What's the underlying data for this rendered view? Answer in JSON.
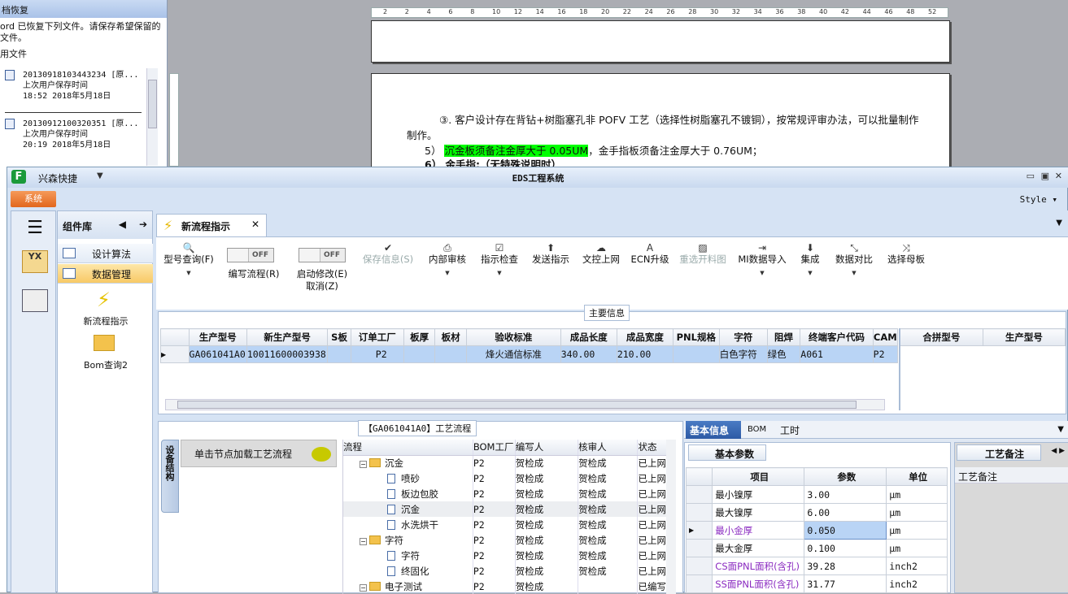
{
  "recovery": {
    "title": "档恢复",
    "message": "ord 已恢复下列文件。请保存希望保留的文件。",
    "section": "用文件",
    "files": [
      {
        "name": "20130918103443234 [原...",
        "label": "上次用户保存时间",
        "time": "18:52 2018年5月18日"
      },
      {
        "name": "20130912100320351 [原...",
        "label": "上次用户保存时间",
        "time": "20:19 2018年5月18日"
      }
    ]
  },
  "ruler": [
    "2",
    "2",
    "4",
    "6",
    "8",
    "10",
    "12",
    "14",
    "16",
    "18",
    "20",
    "22",
    "24",
    "26",
    "28",
    "30",
    "32",
    "34",
    "36",
    "38",
    "40",
    "42",
    "44",
    "46",
    "48",
    "52"
  ],
  "doc": {
    "line1": "③. 客户设计存在背钻+树脂塞孔非 POFV 工艺（选择性树脂塞孔不镀铜），按常规评审办法，可以批量制作",
    "line1b": "制作。",
    "line2_num": "5）",
    "line2_hl": "沉金板须备注金厚大于 0.05UM",
    "line2_rest": "，金手指板须备注金厚大于 0.76UM；",
    "line3": "6） 金手指:（无特殊说明时）"
  },
  "window": {
    "app": "兴森快捷",
    "caption": "EDS工程系统",
    "style": "Style",
    "system_tab": "系统"
  },
  "nav": {
    "lib_title": "组件库",
    "items": [
      "设计算法",
      "数据管理"
    ],
    "big_items": [
      "新流程指示",
      "Bom查询2"
    ]
  },
  "tab": {
    "label": "新流程指示"
  },
  "toolbar": {
    "model_query": "型号查询(F)",
    "write_flow": "编写流程(R)",
    "start_modify": "启动修改(E)",
    "cancel": "取消(Z)",
    "off": "OFF",
    "buttons": [
      "保存信息(S)",
      "内部审核",
      "指示检查",
      "发送指示",
      "文控上网",
      "ECN升级",
      "重选开料图",
      "MI数据导入",
      "集成",
      "数据对比",
      "选择母板"
    ]
  },
  "main": {
    "legend": "主要信息",
    "columns": [
      "生产型号",
      "新生产型号",
      "S板",
      "订单工厂",
      "板厚",
      "板材",
      "验收标准",
      "成品长度",
      "成品宽度",
      "PNL规格",
      "字符",
      "阻焊",
      "终端客户代码",
      "CAM"
    ],
    "row": [
      "GA061041A0",
      "10011600003938",
      "",
      "P2",
      "",
      "",
      "烽火通信标准",
      "340.00",
      "210.00",
      "",
      "白色字符",
      "绿色",
      "A061",
      "P2"
    ],
    "side_columns": [
      "合拼型号",
      "生产型号"
    ]
  },
  "process": {
    "legend": "【GA061041A0】工艺流程",
    "vtab": "设备结构",
    "click": "单击节点加载工艺流程",
    "columns": [
      "流程",
      "BOM工厂",
      "编写人",
      "核审人",
      "状态"
    ],
    "rows": [
      {
        "name": "沉金",
        "f": "P2",
        "w": "贺检成",
        "r": "贺检成",
        "s": "已上网"
      },
      {
        "name": "喷砂",
        "f": "P2",
        "w": "贺检成",
        "r": "贺检成",
        "s": "已上网"
      },
      {
        "name": "板边包胶",
        "f": "P2",
        "w": "贺检成",
        "r": "贺检成",
        "s": "已上网"
      },
      {
        "name": "沉金",
        "f": "P2",
        "w": "贺检成",
        "r": "贺检成",
        "s": "已上网"
      },
      {
        "name": "水洗烘干",
        "f": "P2",
        "w": "贺检成",
        "r": "贺检成",
        "s": "已上网"
      },
      {
        "name": "字符",
        "f": "P2",
        "w": "贺检成",
        "r": "贺检成",
        "s": "已上网"
      },
      {
        "name": "字符",
        "f": "P2",
        "w": "贺检成",
        "r": "贺检成",
        "s": "已上网"
      },
      {
        "name": "终固化",
        "f": "P2",
        "w": "贺检成",
        "r": "贺检成",
        "s": "已上网"
      },
      {
        "name": "电子测试",
        "f": "P2",
        "w": "贺检成",
        "r": "",
        "s": "已编写"
      }
    ]
  },
  "params": {
    "tabs": [
      "基本信息",
      "BOM",
      "工时"
    ],
    "sub_tab": "基本参数",
    "columns": [
      "项目",
      "参数",
      "单位"
    ],
    "rows": [
      {
        "item": "最小镍厚",
        "val": "3.00",
        "unit": "μm"
      },
      {
        "item": "最大镍厚",
        "val": "6.00",
        "unit": "μm"
      },
      {
        "item": "最小金厚",
        "val": "0.050",
        "unit": "μm"
      },
      {
        "item": "最大金厚",
        "val": "0.100",
        "unit": "μm"
      },
      {
        "item": "CS面PNL面积(含孔)",
        "val": "39.28",
        "unit": "inch2"
      },
      {
        "item": "SS面PNL面积(含孔)",
        "val": "31.77",
        "unit": "inch2"
      }
    ],
    "remark_tab": "工艺备注",
    "remark_header": "工艺备注"
  }
}
